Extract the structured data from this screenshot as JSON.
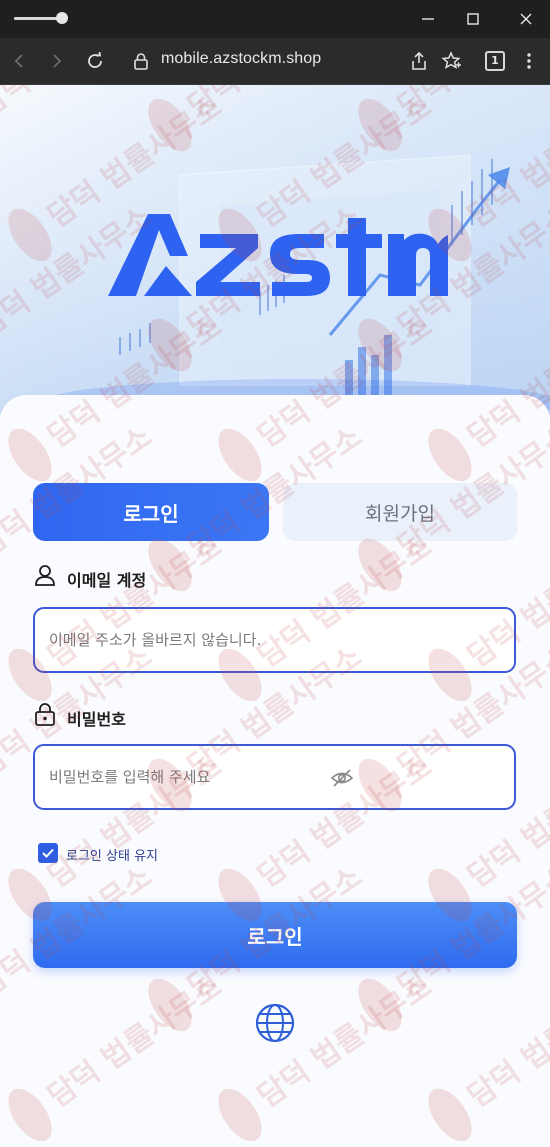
{
  "browser": {
    "url": "mobile.azstockm.shop",
    "tab_count": "1"
  },
  "brand": {
    "logo_text": "Azstm",
    "accent_color": "#2f66f0"
  },
  "tabs": {
    "login": "로그인",
    "signup": "회원가입"
  },
  "email": {
    "label": "이메일 계정",
    "placeholder": "이메일 주소가 올바르지 않습니다."
  },
  "password": {
    "label": "비밀번호",
    "placeholder": "비밀번호를 입력해 주세요"
  },
  "remember": {
    "label": "로그인 상태 유지",
    "checked": true
  },
  "submit": {
    "label": "로그인"
  },
  "watermark": {
    "text": "담덕 법률사무소"
  },
  "icons": {
    "email": "user-icon",
    "password": "lock-icon",
    "visibility": "eye-off-icon",
    "language": "globe-icon"
  }
}
